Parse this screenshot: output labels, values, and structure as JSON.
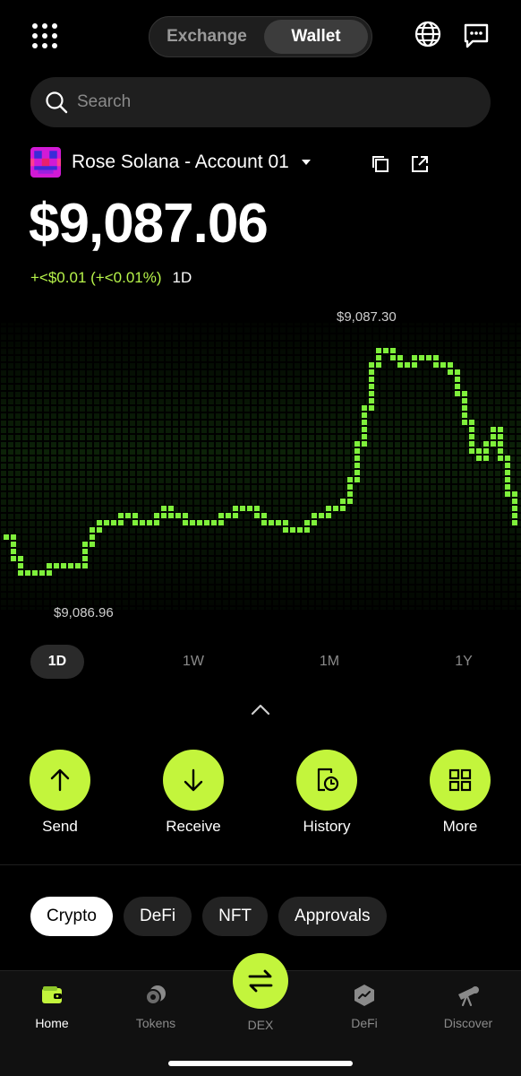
{
  "header": {
    "segments": [
      "Exchange",
      "Wallet"
    ],
    "active_segment": "Wallet"
  },
  "search": {
    "placeholder": "Search"
  },
  "account": {
    "name": "Rose Solana  - Account 01",
    "balance": "$9,087.06",
    "change": "+<$0.01 (+<0.01%)",
    "change_period": "1D",
    "accent_color": "#b7f34a"
  },
  "chart": {
    "high_label": "$9,087.30",
    "low_label": "$9,086.96"
  },
  "chart_data": {
    "type": "line",
    "color": "#7ff03b",
    "style": "dot-matrix",
    "ylim": [
      9086.96,
      9087.3
    ],
    "values": [
      9087.03,
      9086.99,
      9086.98,
      9086.98,
      9086.99,
      9087.0,
      9086.99,
      9086.99,
      9087.04,
      9087.05,
      9087.05,
      9087.06,
      9087.06,
      9087.05,
      9087.05,
      9087.07,
      9087.07,
      9087.06,
      9087.05,
      9087.05,
      9087.05,
      9087.06,
      9087.07,
      9087.08,
      9087.07,
      9087.06,
      9087.05,
      9087.05,
      9087.04,
      9087.05,
      9087.06,
      9087.07,
      9087.07,
      9087.08,
      9087.12,
      9087.2,
      9087.28,
      9087.3,
      9087.29,
      9087.27,
      9087.28,
      9087.29,
      9087.28,
      9087.27,
      9087.26,
      9087.2,
      9087.14,
      9087.16,
      9087.19,
      9087.12,
      9087.05
    ],
    "high": 9087.3,
    "low": 9086.96
  },
  "ranges": [
    "1D",
    "1W",
    "1M",
    "1Y"
  ],
  "active_range": "1D",
  "actions": [
    {
      "label": "Send",
      "icon": "arrow-up-icon"
    },
    {
      "label": "Receive",
      "icon": "arrow-down-icon"
    },
    {
      "label": "History",
      "icon": "history-icon"
    },
    {
      "label": "More",
      "icon": "grid-icon"
    }
  ],
  "chips": [
    "Crypto",
    "DeFi",
    "NFT",
    "Approvals"
  ],
  "active_chip": "Crypto",
  "bottom_nav": [
    {
      "label": "Home",
      "icon": "wallet-icon"
    },
    {
      "label": "Tokens",
      "icon": "tokens-icon"
    },
    {
      "label": "DEX",
      "icon": "swap-icon"
    },
    {
      "label": "DeFi",
      "icon": "defi-icon"
    },
    {
      "label": "Discover",
      "icon": "telescope-icon"
    }
  ],
  "active_nav": "Home"
}
